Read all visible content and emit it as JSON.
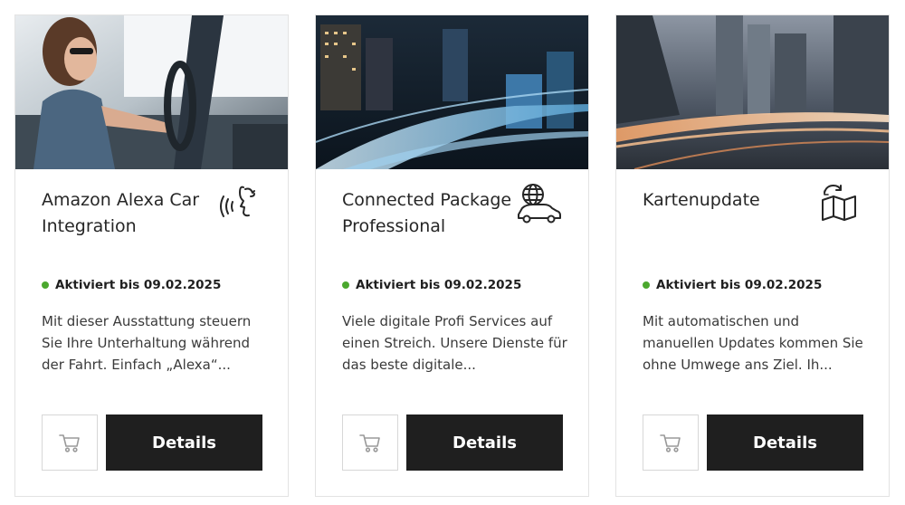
{
  "colors": {
    "status_active": "#4ba82e",
    "details_button_bg": "#1f1f1f",
    "card_border": "#e3e3e3"
  },
  "cards": [
    {
      "title": "Amazon Alexa Car Integration",
      "icon": "voice-assistant-icon",
      "status": "Aktiviert bis 09.02.2025",
      "description": "Mit dieser Ausstattung steuern Sie Ihre Unterhaltung während der Fahrt. Einfach „Alexa“...",
      "cart_icon": "cart-icon",
      "details_label": "Details"
    },
    {
      "title": "Connected Package Professional",
      "icon": "connected-car-globe-icon",
      "status": "Aktiviert bis 09.02.2025",
      "description": "Viele digitale Profi Services auf einen Streich. Unsere Dienste für das beste digitale...",
      "cart_icon": "cart-icon",
      "details_label": "Details"
    },
    {
      "title": "Kartenupdate",
      "icon": "map-update-icon",
      "status": "Aktiviert bis 09.02.2025",
      "description": "Mit automatischen und manuellen Updates kommen Sie ohne Umwege ans Ziel. Ih...",
      "cart_icon": "cart-icon",
      "details_label": "Details"
    }
  ]
}
